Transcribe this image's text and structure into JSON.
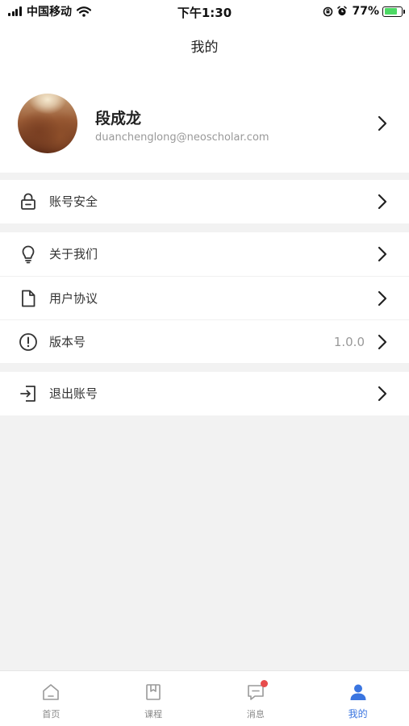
{
  "status_bar": {
    "carrier": "中国移动",
    "time": "下午1:30",
    "battery_percent": "77%",
    "battery_level": 0.77,
    "battery_color": "#4cd964"
  },
  "nav": {
    "title": "我的"
  },
  "profile": {
    "name": "段成龙",
    "email": "duanchenglong@neoscholar.com"
  },
  "menu": {
    "account_security": {
      "label": "账号安全",
      "icon": "lock-icon"
    },
    "about_us": {
      "label": "关于我们",
      "icon": "lightbulb-icon"
    },
    "user_agreement": {
      "label": "用户协议",
      "icon": "document-icon"
    },
    "version": {
      "label": "版本号",
      "value": "1.0.0",
      "icon": "info-circle-icon"
    },
    "logout": {
      "label": "退出账号",
      "icon": "logout-icon"
    }
  },
  "tabs": [
    {
      "label": "首页",
      "icon": "home-icon"
    },
    {
      "label": "课程",
      "icon": "course-book-icon"
    },
    {
      "label": "消息",
      "icon": "message-icon",
      "badge": true
    },
    {
      "label": "我的",
      "icon": "user-icon",
      "active": true
    }
  ],
  "colors": {
    "accent": "#3a75e0",
    "badge": "#e74c4c",
    "background": "#f2f2f2"
  }
}
